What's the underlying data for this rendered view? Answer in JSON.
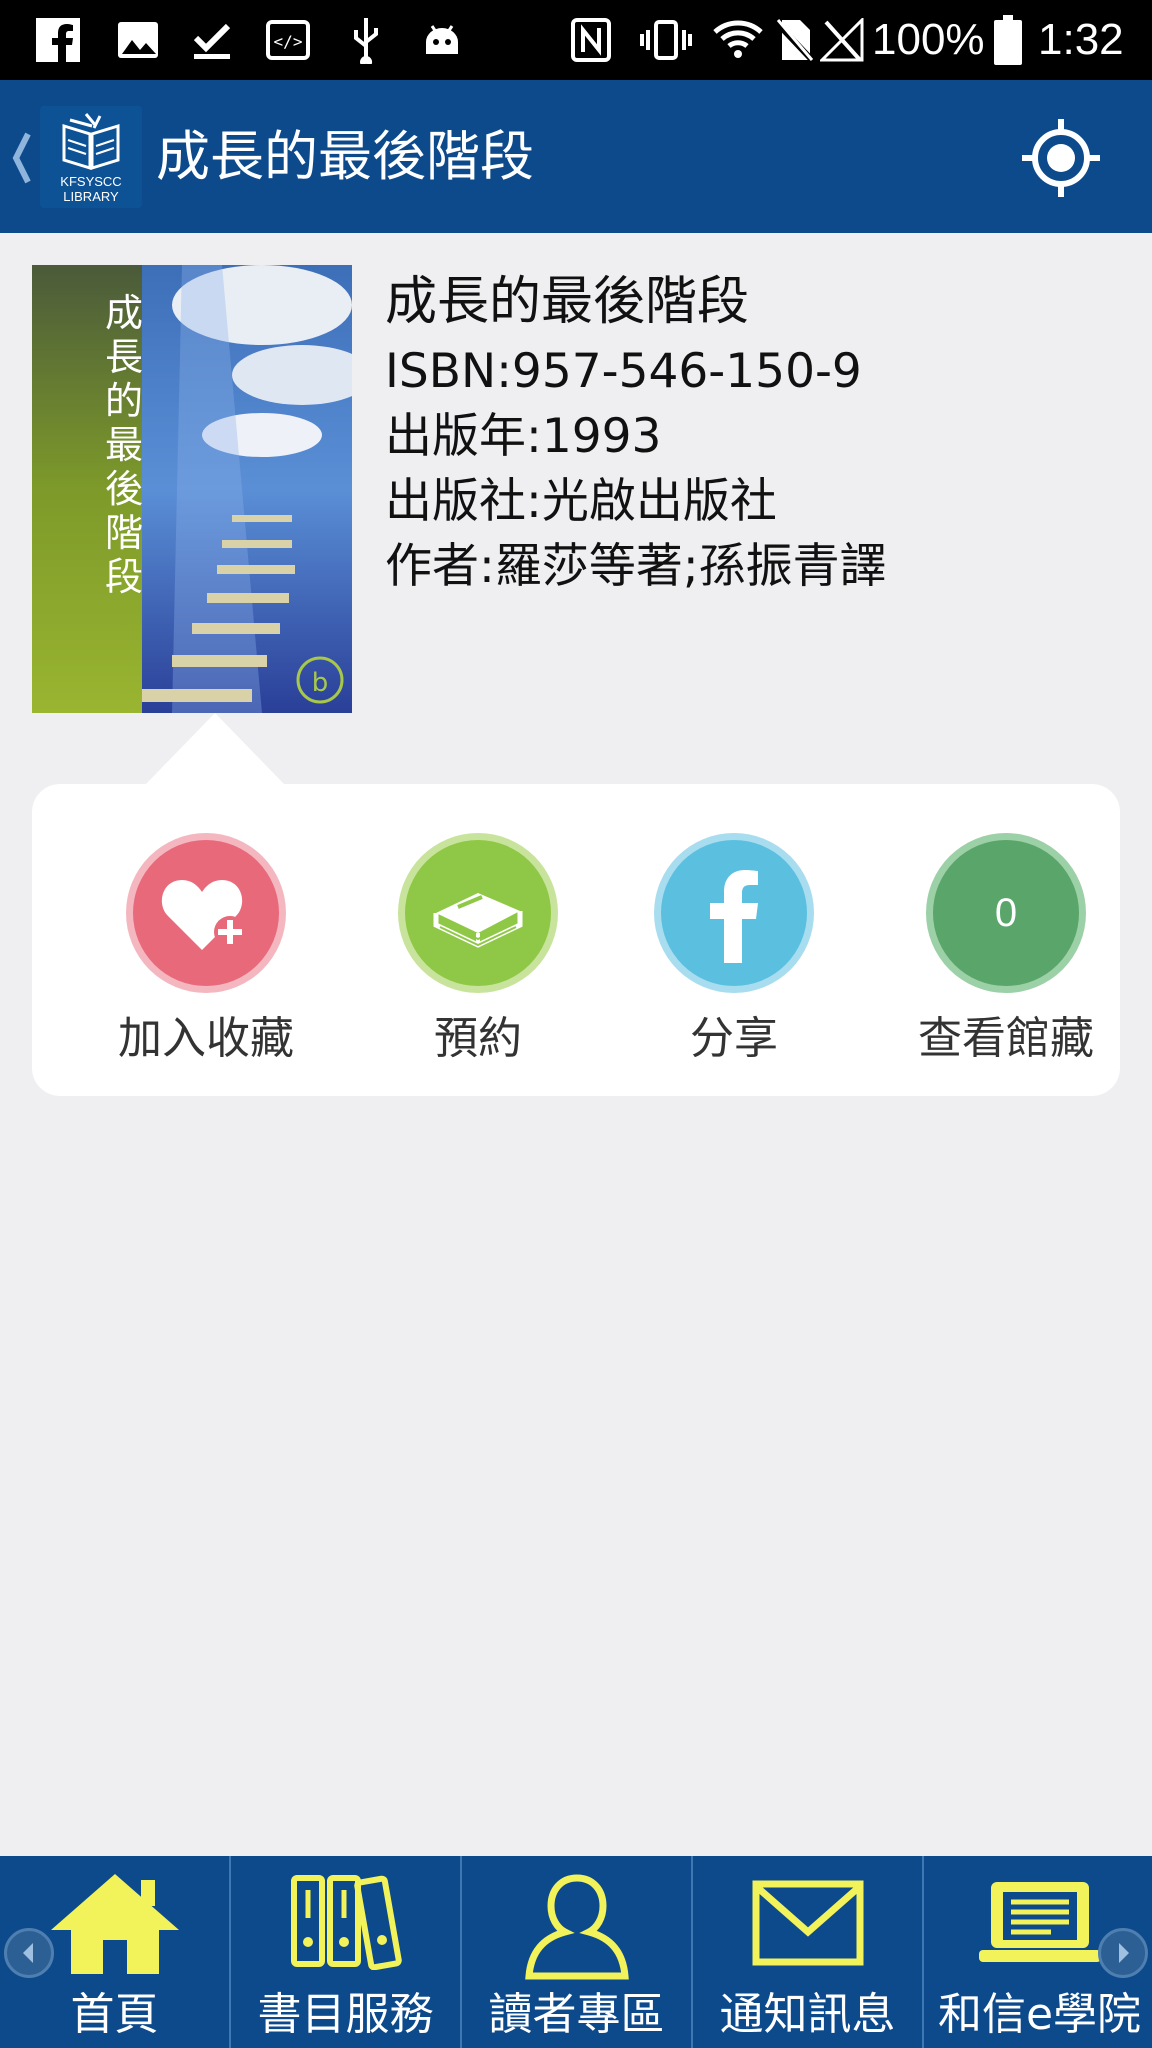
{
  "status_bar": {
    "battery_percent": "100%",
    "time": "1:32",
    "icons": [
      "facebook-icon",
      "image-icon",
      "download-done-icon",
      "code-icon",
      "usb-icon",
      "android-icon",
      "nfc-icon",
      "vibrate-icon",
      "wifi-icon",
      "no-sim-icon",
      "signal-icon",
      "battery-icon"
    ]
  },
  "app_bar": {
    "title": "成長的最後階段",
    "logo_line1": "KFSYSCC",
    "logo_line2": "LIBRARY"
  },
  "book": {
    "title": "成長的最後階段",
    "isbn": "ISBN:957-546-150-9",
    "year": "出版年:1993",
    "publisher": "出版社:光啟出版社",
    "author": "作者:羅莎等著;孫振青譯",
    "cover_title": "成長的最後階段"
  },
  "actions": [
    {
      "label": "加入收藏",
      "icon": "heart-add-icon",
      "color": "#e8697a"
    },
    {
      "label": "預約",
      "icon": "book-icon",
      "color": "#8fc846"
    },
    {
      "label": "分享",
      "icon": "facebook-icon",
      "color": "#5bbfe0"
    },
    {
      "label": "查看館藏",
      "icon": "count-badge",
      "color": "#5aa56a",
      "count": "0"
    }
  ],
  "bottom_nav": [
    {
      "label": "首頁",
      "icon": "home-icon"
    },
    {
      "label": "書目服務",
      "icon": "binders-icon"
    },
    {
      "label": "讀者專區",
      "icon": "person-icon"
    },
    {
      "label": "通知訊息",
      "icon": "envelope-icon"
    },
    {
      "label": "和信e學院",
      "icon": "laptop-icon"
    }
  ],
  "colors": {
    "primary": "#0d4a8c",
    "background": "#efeef1",
    "nav_icon": "#f2f25a"
  }
}
